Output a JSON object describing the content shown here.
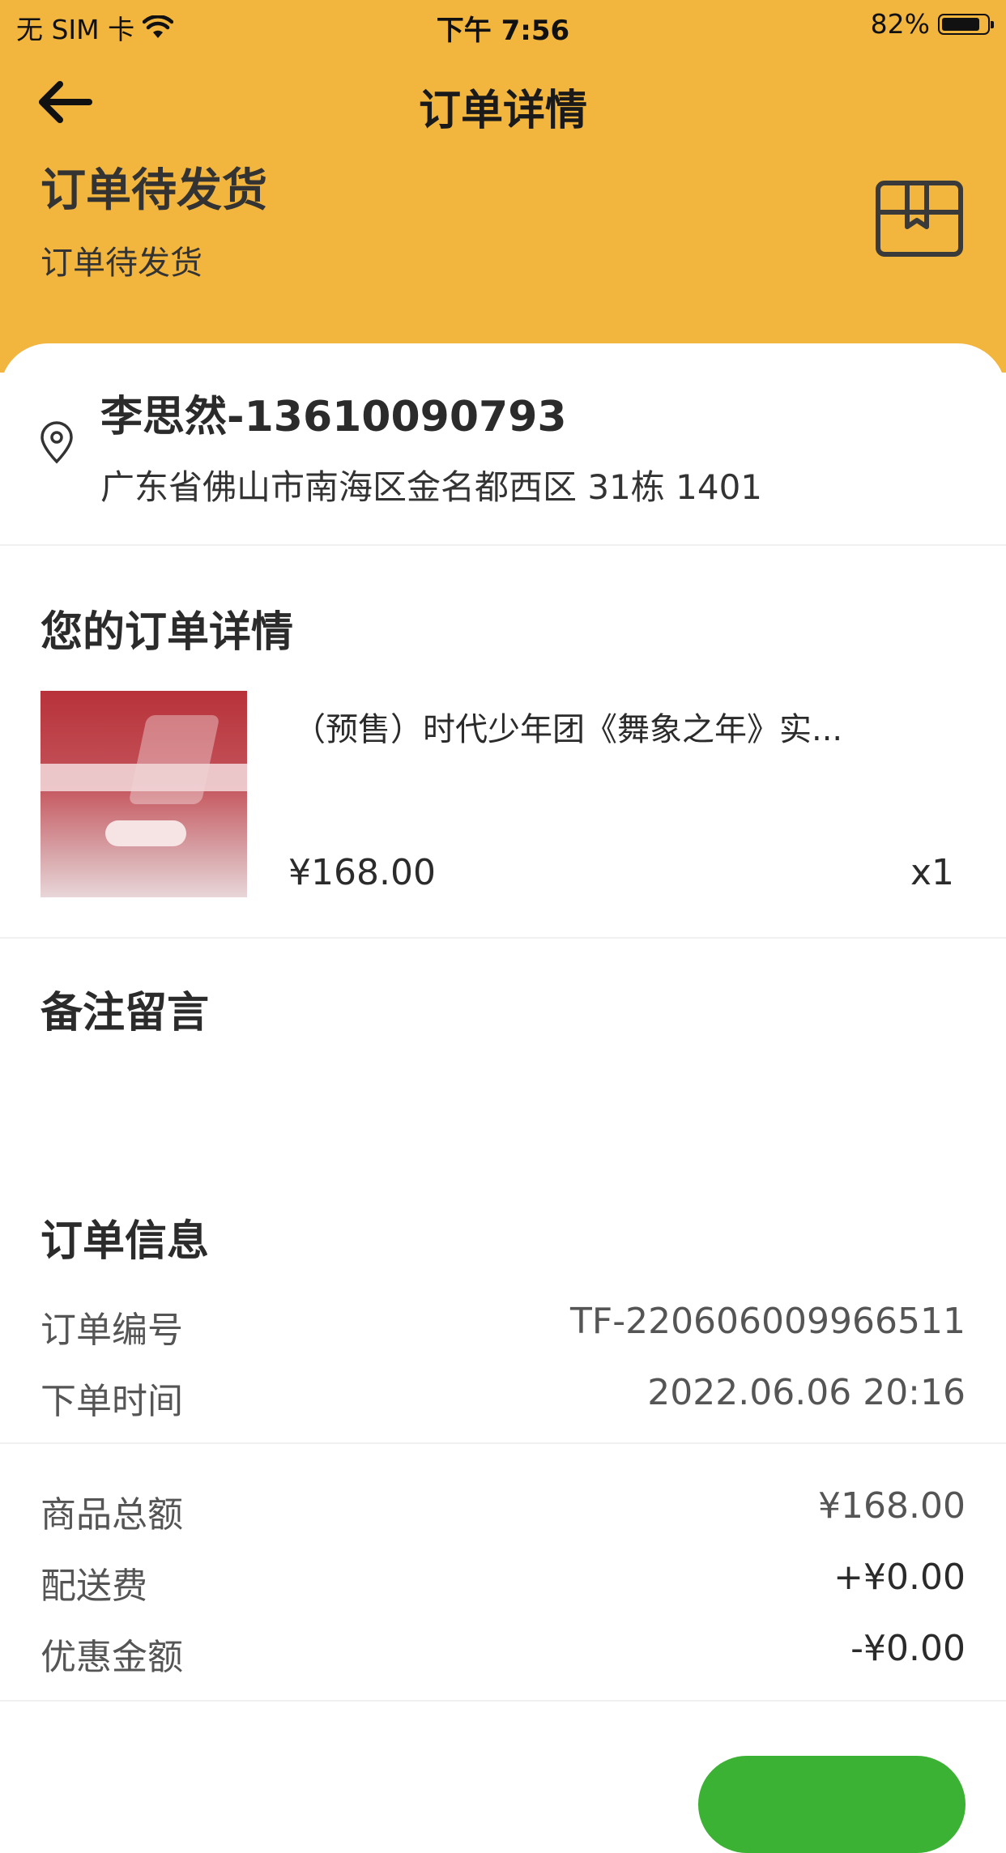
{
  "status_bar": {
    "carrier": "无 SIM 卡",
    "time": "下午 7:56",
    "battery": "82%"
  },
  "nav": {
    "title": "订单详情"
  },
  "order_status": {
    "title": "订单待发货",
    "subtitle": "订单待发货"
  },
  "address": {
    "name_phone": "李思然-13610090793",
    "detail": "广东省佛山市南海区金名都西区 31栋 1401"
  },
  "order_details": {
    "title": "您的订单详情",
    "product": {
      "name": "（预售）时代少年团《舞象之年》实...",
      "price": "¥168.00",
      "qty": "x1"
    }
  },
  "remarks": {
    "title": "备注留言"
  },
  "order_info": {
    "title": "订单信息",
    "rows": [
      {
        "label": "订单编号",
        "value": "TF-220606009966511"
      },
      {
        "label": "下单时间",
        "value": "2022.06.06 20:16"
      }
    ]
  },
  "amounts": {
    "rows": [
      {
        "label": "商品总额",
        "value": "¥168.00"
      },
      {
        "label": "配送费",
        "value": "+¥0.00"
      },
      {
        "label": "优惠金额",
        "value": "-¥0.00"
      }
    ]
  },
  "colors": {
    "header_bg": "#F2B53E",
    "button_green": "#3cb234"
  }
}
